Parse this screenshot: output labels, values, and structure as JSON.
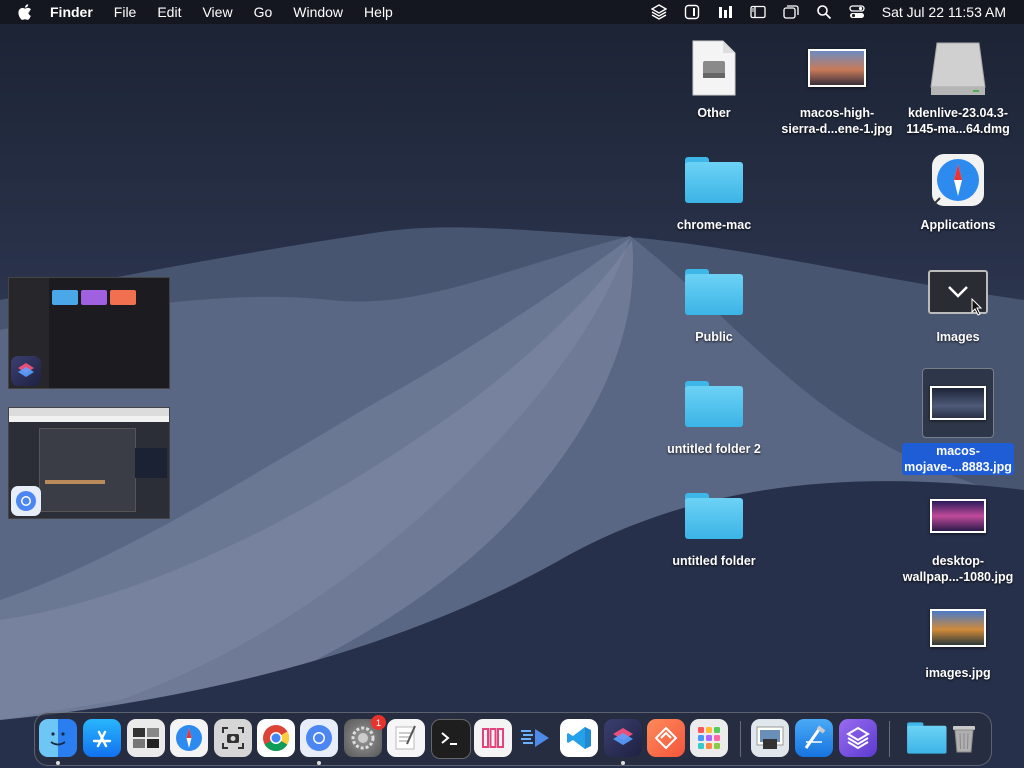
{
  "menubar": {
    "app_name": "Finder",
    "items": [
      "File",
      "Edit",
      "View",
      "Go",
      "Window",
      "Help"
    ],
    "clock": "Sat Jul 22  11:53 AM",
    "status_icons": [
      "stack-icon",
      "box-icon",
      "bars-icon",
      "sidebar-icon",
      "windows-icon",
      "search-icon",
      "control-center-icon"
    ]
  },
  "desktop": {
    "icons": [
      {
        "label": "Other",
        "kind": "drive-doc"
      },
      {
        "label": "macos-high-\nsierra-d...ene-1.jpg",
        "kind": "image"
      },
      {
        "label": "kdenlive-23.04.3-\n1145-ma...64.dmg",
        "kind": "disk"
      },
      {
        "label": "chrome-mac",
        "kind": "folder"
      },
      {
        "label": "Applications",
        "kind": "safari-alias"
      },
      {
        "label": "Public",
        "kind": "folder"
      },
      {
        "label": "Images",
        "kind": "stack"
      },
      {
        "label": "untitled folder 2",
        "kind": "folder"
      },
      {
        "label": "macos-\nmojave-...8883.jpg",
        "kind": "image",
        "selected": true
      },
      {
        "label": "untitled folder",
        "kind": "folder"
      },
      {
        "label": "desktop-\nwallpap...-1080.jpg",
        "kind": "image"
      },
      {
        "label": "images.jpg",
        "kind": "image"
      }
    ]
  },
  "dock": {
    "items": [
      {
        "name": "finder-icon",
        "color": "#2a8cf0",
        "running": true
      },
      {
        "name": "app-store-icon",
        "color": "#1a8ff5",
        "running": false
      },
      {
        "name": "preview-icon",
        "color": "#e9e9e9",
        "running": false
      },
      {
        "name": "safari-icon",
        "color": "#2c86f3",
        "running": false
      },
      {
        "name": "screenshot-icon",
        "color": "#d8d8d8",
        "running": false
      },
      {
        "name": "chrome-icon",
        "color": "#ffffff",
        "running": false
      },
      {
        "name": "chromium-icon",
        "color": "#4b86f2",
        "running": true
      },
      {
        "name": "system-settings-icon",
        "color": "#8a8a8a",
        "running": false,
        "badge": "1"
      },
      {
        "name": "textedit-icon",
        "color": "#f2f2f2",
        "running": false
      },
      {
        "name": "terminal-icon",
        "color": "#1e1e1e",
        "running": false
      },
      {
        "name": "columns-app-icon",
        "color": "#f4f4f4",
        "running": false
      },
      {
        "name": "kdenlive-icon",
        "color": "#2b3b5a",
        "running": false
      },
      {
        "name": "vscode-icon",
        "color": "#ffffff",
        "running": false
      },
      {
        "name": "shortcuts-icon",
        "color": "#3a3f6b",
        "running": true
      },
      {
        "name": "stackpath-icon",
        "color": "#ff6a4a",
        "running": false
      },
      {
        "name": "launchpad-icon",
        "color": "#e8e8e8",
        "running": false
      },
      {
        "name": "preview-photos-icon",
        "color": "#cfd8e0",
        "running": false
      },
      {
        "name": "xcode-icon",
        "color": "#1b8cf0",
        "running": false
      },
      {
        "name": "layers-app-icon",
        "color": "#7b4fe0",
        "running": false
      },
      {
        "name": "downloads-folder-icon",
        "color": "#5cc6f2",
        "running": false
      },
      {
        "name": "trash-icon",
        "color": "#9a9a9a",
        "running": false
      }
    ]
  }
}
